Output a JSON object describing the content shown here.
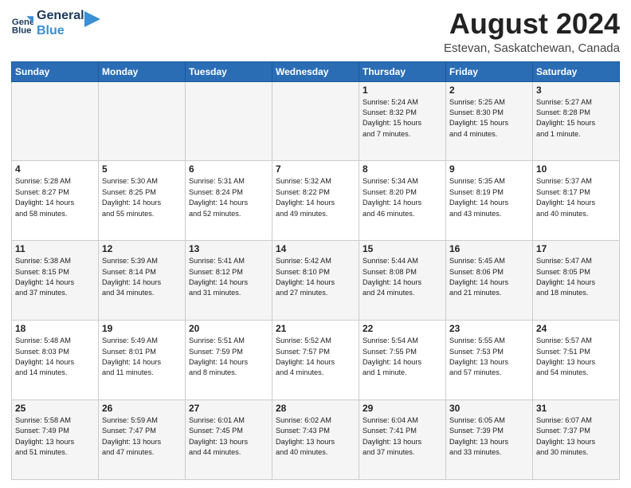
{
  "logo": {
    "line1": "General",
    "line2": "Blue"
  },
  "title": "August 2024",
  "subtitle": "Estevan, Saskatchewan, Canada",
  "weekdays": [
    "Sunday",
    "Monday",
    "Tuesday",
    "Wednesday",
    "Thursday",
    "Friday",
    "Saturday"
  ],
  "weeks": [
    [
      {
        "day": "",
        "info": ""
      },
      {
        "day": "",
        "info": ""
      },
      {
        "day": "",
        "info": ""
      },
      {
        "day": "",
        "info": ""
      },
      {
        "day": "1",
        "info": "Sunrise: 5:24 AM\nSunset: 8:32 PM\nDaylight: 15 hours\nand 7 minutes."
      },
      {
        "day": "2",
        "info": "Sunrise: 5:25 AM\nSunset: 8:30 PM\nDaylight: 15 hours\nand 4 minutes."
      },
      {
        "day": "3",
        "info": "Sunrise: 5:27 AM\nSunset: 8:28 PM\nDaylight: 15 hours\nand 1 minute."
      }
    ],
    [
      {
        "day": "4",
        "info": "Sunrise: 5:28 AM\nSunset: 8:27 PM\nDaylight: 14 hours\nand 58 minutes."
      },
      {
        "day": "5",
        "info": "Sunrise: 5:30 AM\nSunset: 8:25 PM\nDaylight: 14 hours\nand 55 minutes."
      },
      {
        "day": "6",
        "info": "Sunrise: 5:31 AM\nSunset: 8:24 PM\nDaylight: 14 hours\nand 52 minutes."
      },
      {
        "day": "7",
        "info": "Sunrise: 5:32 AM\nSunset: 8:22 PM\nDaylight: 14 hours\nand 49 minutes."
      },
      {
        "day": "8",
        "info": "Sunrise: 5:34 AM\nSunset: 8:20 PM\nDaylight: 14 hours\nand 46 minutes."
      },
      {
        "day": "9",
        "info": "Sunrise: 5:35 AM\nSunset: 8:19 PM\nDaylight: 14 hours\nand 43 minutes."
      },
      {
        "day": "10",
        "info": "Sunrise: 5:37 AM\nSunset: 8:17 PM\nDaylight: 14 hours\nand 40 minutes."
      }
    ],
    [
      {
        "day": "11",
        "info": "Sunrise: 5:38 AM\nSunset: 8:15 PM\nDaylight: 14 hours\nand 37 minutes."
      },
      {
        "day": "12",
        "info": "Sunrise: 5:39 AM\nSunset: 8:14 PM\nDaylight: 14 hours\nand 34 minutes."
      },
      {
        "day": "13",
        "info": "Sunrise: 5:41 AM\nSunset: 8:12 PM\nDaylight: 14 hours\nand 31 minutes."
      },
      {
        "day": "14",
        "info": "Sunrise: 5:42 AM\nSunset: 8:10 PM\nDaylight: 14 hours\nand 27 minutes."
      },
      {
        "day": "15",
        "info": "Sunrise: 5:44 AM\nSunset: 8:08 PM\nDaylight: 14 hours\nand 24 minutes."
      },
      {
        "day": "16",
        "info": "Sunrise: 5:45 AM\nSunset: 8:06 PM\nDaylight: 14 hours\nand 21 minutes."
      },
      {
        "day": "17",
        "info": "Sunrise: 5:47 AM\nSunset: 8:05 PM\nDaylight: 14 hours\nand 18 minutes."
      }
    ],
    [
      {
        "day": "18",
        "info": "Sunrise: 5:48 AM\nSunset: 8:03 PM\nDaylight: 14 hours\nand 14 minutes."
      },
      {
        "day": "19",
        "info": "Sunrise: 5:49 AM\nSunset: 8:01 PM\nDaylight: 14 hours\nand 11 minutes."
      },
      {
        "day": "20",
        "info": "Sunrise: 5:51 AM\nSunset: 7:59 PM\nDaylight: 14 hours\nand 8 minutes."
      },
      {
        "day": "21",
        "info": "Sunrise: 5:52 AM\nSunset: 7:57 PM\nDaylight: 14 hours\nand 4 minutes."
      },
      {
        "day": "22",
        "info": "Sunrise: 5:54 AM\nSunset: 7:55 PM\nDaylight: 14 hours\nand 1 minute."
      },
      {
        "day": "23",
        "info": "Sunrise: 5:55 AM\nSunset: 7:53 PM\nDaylight: 13 hours\nand 57 minutes."
      },
      {
        "day": "24",
        "info": "Sunrise: 5:57 AM\nSunset: 7:51 PM\nDaylight: 13 hours\nand 54 minutes."
      }
    ],
    [
      {
        "day": "25",
        "info": "Sunrise: 5:58 AM\nSunset: 7:49 PM\nDaylight: 13 hours\nand 51 minutes."
      },
      {
        "day": "26",
        "info": "Sunrise: 5:59 AM\nSunset: 7:47 PM\nDaylight: 13 hours\nand 47 minutes."
      },
      {
        "day": "27",
        "info": "Sunrise: 6:01 AM\nSunset: 7:45 PM\nDaylight: 13 hours\nand 44 minutes."
      },
      {
        "day": "28",
        "info": "Sunrise: 6:02 AM\nSunset: 7:43 PM\nDaylight: 13 hours\nand 40 minutes."
      },
      {
        "day": "29",
        "info": "Sunrise: 6:04 AM\nSunset: 7:41 PM\nDaylight: 13 hours\nand 37 minutes."
      },
      {
        "day": "30",
        "info": "Sunrise: 6:05 AM\nSunset: 7:39 PM\nDaylight: 13 hours\nand 33 minutes."
      },
      {
        "day": "31",
        "info": "Sunrise: 6:07 AM\nSunset: 7:37 PM\nDaylight: 13 hours\nand 30 minutes."
      }
    ]
  ]
}
